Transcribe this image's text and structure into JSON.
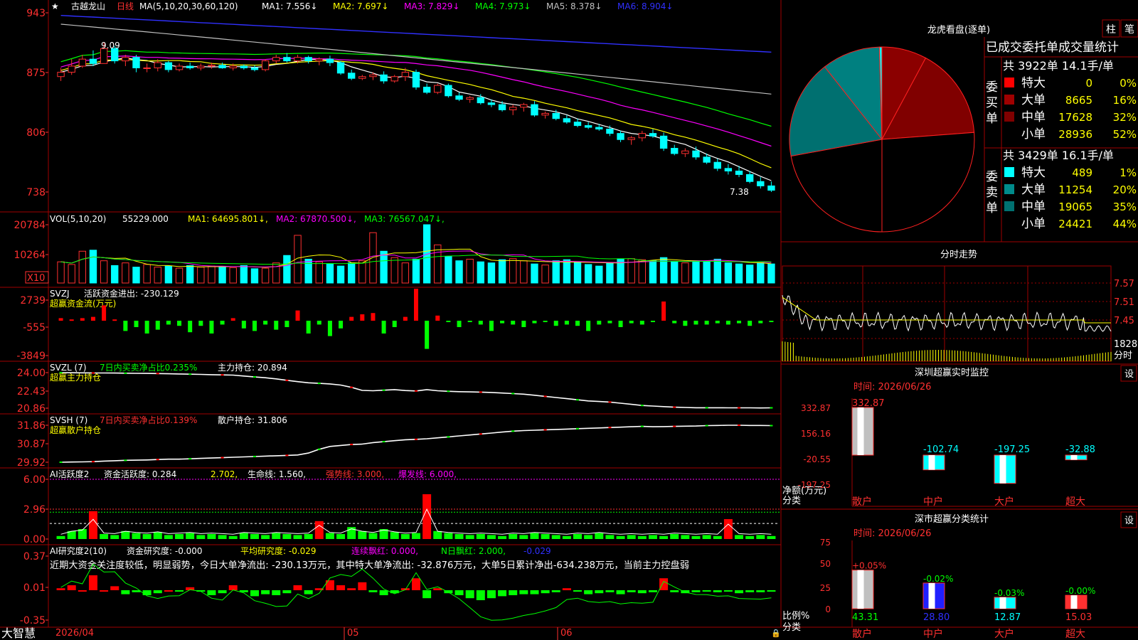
{
  "colors": {
    "red": "#ff3030",
    "cyan": "#00ffff",
    "white": "#ffffff",
    "yellow": "#ffff00",
    "magenta": "#ff00ff",
    "green": "#00ff00",
    "blue": "#3030ff",
    "gray": "#c0c0c0",
    "darkred": "#8b0000",
    "teal": "#008080",
    "grid": "#a00000"
  },
  "main_chart": {
    "star": "★",
    "stock_name": "古越龙山",
    "period": "日线",
    "ma_params": "MA(5,10,20,30,60,120)",
    "ma_values": [
      {
        "label": "MA1:",
        "value": "7.556",
        "arrow": "↓",
        "color": "#ffffff"
      },
      {
        "label": "MA2:",
        "value": "7.697",
        "arrow": "↓",
        "color": "#ffff00"
      },
      {
        "label": "MA3:",
        "value": "7.829",
        "arrow": "↓",
        "color": "#ff00ff"
      },
      {
        "label": "MA4:",
        "value": "7.973",
        "arrow": "↓",
        "color": "#00ff00"
      },
      {
        "label": "MA5:",
        "value": "8.378",
        "arrow": "↓",
        "color": "#c0c0c0"
      },
      {
        "label": "MA6:",
        "value": "8.904",
        "arrow": "↓",
        "color": "#3030ff"
      }
    ],
    "y_labels": [
      "943",
      "875",
      "806",
      "738"
    ],
    "high_label": "9.09",
    "low_label": "7.38"
  },
  "volume_panel": {
    "title": "VOL(5,10,20)",
    "current": "55229.000",
    "ma": [
      {
        "label": "MA1:",
        "value": "64695.801",
        "color": "#ffff00"
      },
      {
        "label": "MA2:",
        "value": "67870.500",
        "color": "#ff00ff"
      },
      {
        "label": "MA3:",
        "value": "76567.047",
        "color": "#00ff00"
      }
    ],
    "y_labels": [
      "20784",
      "10264"
    ],
    "unit": "X10"
  },
  "svzj_panel": {
    "title": "SVZJ",
    "line1": "活跃资金进出: -230.129",
    "line2": "超赢资金流(万元)",
    "y_labels": [
      "2739",
      "-555",
      "-3849"
    ]
  },
  "svzl_panel": {
    "title": "SVZL (7)",
    "ratio_text": "7日内买卖净占比0.235%",
    "hold_text": "主力持仓: 20.894",
    "subtitle": "超赢主力持仓",
    "y_labels": [
      "24.00",
      "22.43",
      "20.86"
    ]
  },
  "svsh_panel": {
    "title": "SVSH (7)",
    "ratio_text": "7日内买卖净占比0.139%",
    "hold_text": "散户持仓: 31.806",
    "subtitle": "超赢散户持仓",
    "y_labels": [
      "31.86",
      "30.87",
      "29.92"
    ]
  },
  "ai_active_panel": {
    "title": "AI活跃度2",
    "text1": "资金活跃度: 0.284",
    "text2": "2.702,",
    "text3": "生命线: 1.560,",
    "text4": "强势线: 3.000,",
    "text5": "爆发线: 6.000,",
    "y_labels": [
      "6.00",
      "2.96",
      "0.00"
    ]
  },
  "ai_research_panel": {
    "title": "AI研究度2(10)",
    "text1": "资金研究度: -0.000",
    "text2": "平均研究度: -0.029",
    "text3": "连续飘红: 0.000,",
    "text4": "N日飘红: 2.000,",
    "text5": "-0.029",
    "commentary": "近期大资金关注度较低，明显弱势，今日大单净流出: -230.13万元，其中特大单净流出: -32.876万元，大单5日累计净出-634.238万元，当前主力控盘弱",
    "y_labels": [
      "0.37",
      "0.01",
      "-0.35"
    ]
  },
  "bottom_bar": {
    "brand": "大智慧",
    "date": "2026/04",
    "month_labels": [
      "05",
      "06"
    ]
  },
  "right_panel": {
    "dragon_title": "龙虎看盘(逐单)",
    "btn1": "柱",
    "btn2": "笔",
    "stats_header": "已成交委托单成交量统计",
    "buy_label": "委买单",
    "sell_label": "委卖单",
    "buy_summary": "共 3922单 14.1手/单",
    "sell_summary": "共 3429单 16.1手/单",
    "buy_rows": [
      {
        "name": "特大",
        "value": "0",
        "pct": "0%",
        "color": "#ff0000"
      },
      {
        "name": "大单",
        "value": "8665",
        "pct": "16%",
        "color": "#a00000"
      },
      {
        "name": "中单",
        "value": "17628",
        "pct": "32%",
        "color": "#800000"
      },
      {
        "name": "小单",
        "value": "28936",
        "pct": "52%",
        "color": "#000000"
      }
    ],
    "sell_rows": [
      {
        "name": "特大",
        "value": "489",
        "pct": "1%",
        "color": "#00ffff"
      },
      {
        "name": "大单",
        "value": "11254",
        "pct": "20%",
        "color": "#008b8b"
      },
      {
        "name": "中单",
        "value": "19065",
        "pct": "35%",
        "color": "#007070"
      },
      {
        "name": "小单",
        "value": "24421",
        "pct": "44%",
        "color": "#000000"
      }
    ],
    "fenshi_title": "分时走势",
    "fenshi_y": [
      "7.57",
      "7.51",
      "7.45"
    ],
    "fenshi_vol": "1828",
    "fenshi_vol_unit": "分时",
    "sz_monitor_title": "深圳超赢实时监控",
    "sz_monitor_btn": "设",
    "sz_monitor_time": "时间: 2026/06/26",
    "sz_monitor_y": [
      "332.87",
      "156.16",
      "-20.55",
      "-197.25"
    ],
    "sz_monitor_unit": "净额(万元)",
    "sz_monitor_cat_label": "分类",
    "sz_monitor_bars": [
      {
        "cat": "散户",
        "value": 332.87,
        "label": "332.87"
      },
      {
        "cat": "中户",
        "value": -102.74,
        "label": "-102.74"
      },
      {
        "cat": "大户",
        "value": -197.25,
        "label": "-197.25"
      },
      {
        "cat": "超大",
        "value": -32.88,
        "label": "-32.88"
      }
    ],
    "sz_class_title": "深市超赢分类统计",
    "sz_class_btn": "设",
    "sz_class_time": "时间: 2026/06/26",
    "sz_class_y": [
      "75",
      "50",
      "25",
      "0"
    ],
    "sz_class_unit": "比例%",
    "sz_class_cat_label": "分类",
    "sz_class_bars": [
      {
        "cat": "散户",
        "value": 43.31,
        "change": "+0.05%",
        "label": "43.31"
      },
      {
        "cat": "中户",
        "value": 28.8,
        "change": "-0.02%",
        "label": "28.80"
      },
      {
        "cat": "大户",
        "value": 12.87,
        "change": "-0.03%",
        "label": "12.87"
      },
      {
        "cat": "超大",
        "value": 15.03,
        "change": "-0.00%",
        "label": "15.03"
      }
    ]
  },
  "chart_data": {
    "type": "candlestick",
    "title": "古越龙山 日线",
    "ylim": [
      7.38,
      9.43
    ],
    "candles": [
      [
        8.7,
        8.8,
        8.65,
        8.75
      ],
      [
        8.75,
        8.9,
        8.72,
        8.82
      ],
      [
        8.82,
        8.95,
        8.8,
        8.9
      ],
      [
        8.9,
        9.0,
        8.82,
        8.85
      ],
      [
        8.85,
        9.09,
        8.85,
        9.02
      ],
      [
        9.02,
        9.05,
        8.85,
        8.88
      ],
      [
        8.88,
        8.95,
        8.82,
        8.92
      ],
      [
        8.92,
        8.95,
        8.75,
        8.8
      ],
      [
        8.8,
        8.85,
        8.75,
        8.8
      ],
      [
        8.8,
        8.9,
        8.76,
        8.86
      ],
      [
        8.86,
        8.88,
        8.75,
        8.78
      ],
      [
        8.78,
        8.85,
        8.76,
        8.82
      ],
      [
        8.82,
        8.86,
        8.78,
        8.8
      ],
      [
        8.8,
        8.85,
        8.77,
        8.82
      ],
      [
        8.82,
        8.86,
        8.79,
        8.83
      ],
      [
        8.83,
        8.86,
        8.79,
        8.8
      ],
      [
        8.8,
        8.85,
        8.77,
        8.82
      ],
      [
        8.82,
        8.84,
        8.78,
        8.8
      ],
      [
        8.8,
        8.83,
        8.76,
        8.78
      ],
      [
        8.78,
        8.9,
        8.76,
        8.88
      ],
      [
        8.88,
        8.95,
        8.85,
        8.92
      ],
      [
        8.92,
        8.97,
        8.86,
        8.88
      ],
      [
        8.88,
        8.95,
        8.85,
        8.92
      ],
      [
        8.92,
        8.94,
        8.85,
        8.88
      ],
      [
        8.88,
        8.92,
        8.83,
        8.9
      ],
      [
        8.9,
        8.94,
        8.82,
        8.86
      ],
      [
        8.86,
        8.88,
        8.72,
        8.74
      ],
      [
        8.74,
        8.78,
        8.66,
        8.68
      ],
      [
        8.68,
        8.72,
        8.66,
        8.7
      ],
      [
        8.7,
        8.75,
        8.66,
        8.72
      ],
      [
        8.72,
        8.76,
        8.62,
        8.65
      ],
      [
        8.65,
        8.72,
        8.63,
        8.7
      ],
      [
        8.7,
        8.8,
        8.65,
        8.75
      ],
      [
        8.75,
        8.78,
        8.55,
        8.58
      ],
      [
        8.58,
        8.62,
        8.5,
        8.52
      ],
      [
        8.52,
        8.62,
        8.5,
        8.6
      ],
      [
        8.6,
        8.62,
        8.46,
        8.48
      ],
      [
        8.48,
        8.52,
        8.42,
        8.44
      ],
      [
        8.44,
        8.48,
        8.4,
        8.46
      ],
      [
        8.46,
        8.5,
        8.38,
        8.4
      ],
      [
        8.4,
        8.44,
        8.35,
        8.38
      ],
      [
        8.38,
        8.42,
        8.3,
        8.32
      ],
      [
        8.32,
        8.38,
        8.26,
        8.35
      ],
      [
        8.35,
        8.4,
        8.3,
        8.38
      ],
      [
        8.38,
        8.42,
        8.24,
        8.26
      ],
      [
        8.26,
        8.3,
        8.22,
        8.28
      ],
      [
        8.28,
        8.32,
        8.2,
        8.22
      ],
      [
        8.22,
        8.26,
        8.16,
        8.18
      ],
      [
        8.18,
        8.22,
        8.12,
        8.14
      ],
      [
        8.14,
        8.18,
        8.1,
        8.12
      ],
      [
        8.12,
        8.16,
        8.08,
        8.1
      ],
      [
        8.1,
        8.14,
        8.02,
        8.05
      ],
      [
        8.05,
        8.08,
        7.95,
        7.98
      ],
      [
        7.98,
        8.02,
        7.92,
        8.0
      ],
      [
        8.0,
        8.08,
        7.96,
        8.05
      ],
      [
        8.05,
        8.1,
        8.0,
        8.02
      ],
      [
        8.02,
        8.06,
        7.85,
        7.88
      ],
      [
        7.88,
        7.92,
        7.8,
        7.82
      ],
      [
        7.82,
        7.88,
        7.78,
        7.85
      ],
      [
        7.85,
        7.9,
        7.75,
        7.78
      ],
      [
        7.78,
        7.82,
        7.7,
        7.72
      ],
      [
        7.72,
        7.76,
        7.62,
        7.65
      ],
      [
        7.65,
        7.7,
        7.58,
        7.62
      ],
      [
        7.62,
        7.68,
        7.55,
        7.58
      ],
      [
        7.58,
        7.62,
        7.48,
        7.5
      ],
      [
        7.5,
        7.55,
        7.42,
        7.45
      ],
      [
        7.45,
        7.5,
        7.38,
        7.4
      ]
    ],
    "volume": [
      40,
      35,
      60,
      62,
      42,
      33,
      38,
      30,
      35,
      30,
      32,
      28,
      33,
      30,
      32,
      31,
      29,
      33,
      27,
      28,
      38,
      52,
      90,
      45,
      40,
      36,
      32,
      38,
      42,
      95,
      60,
      48,
      38,
      45,
      110,
      72,
      50,
      42,
      45,
      40,
      38,
      44,
      46,
      42,
      36,
      34,
      42,
      44,
      40,
      35,
      32,
      38,
      45,
      46,
      44,
      42,
      48,
      40,
      38,
      42,
      40,
      45,
      38,
      36,
      34,
      38,
      36
    ],
    "svzj": [
      0.2,
      0.1,
      0.2,
      0.3,
      1.2,
      0.1,
      -0.8,
      -0.5,
      -1.0,
      -0.7,
      -0.3,
      -0.4,
      -0.9,
      -0.4,
      -1.0,
      -0.3,
      0.2,
      -0.6,
      -0.8,
      -0.3,
      -0.7,
      -0.5,
      0.8,
      -1.0,
      -0.3,
      -1.2,
      -0.6,
      0.3,
      0.5,
      0.6,
      -1.0,
      -0.5,
      0.3,
      2.5,
      -2.2,
      0.4,
      -0.1,
      -0.5,
      -0.1,
      -0.3,
      -0.8,
      -0.2,
      -0.3,
      -0.5,
      -0.2,
      -0.1,
      -0.4,
      -0.3,
      -0.4,
      -0.8,
      -0.3,
      -0.2,
      -0.5,
      -0.2,
      -0.3,
      -0.1,
      1.5,
      -0.2,
      -0.4,
      -0.3,
      -0.3,
      -0.2,
      -0.3,
      -0.2,
      -0.4,
      -0.2,
      -0.1
    ],
    "svzl": [
      24.0,
      23.99,
      23.98,
      23.97,
      23.97,
      23.96,
      23.95,
      23.94,
      23.93,
      23.92,
      23.9,
      23.88,
      23.86,
      23.84,
      23.82,
      23.8,
      23.78,
      23.7,
      23.62,
      23.55,
      23.45,
      23.32,
      23.2,
      23.1,
      23.05,
      23.0,
      22.9,
      22.7,
      22.43,
      22.4,
      22.45,
      22.5,
      22.42,
      22.38,
      22.5,
      22.4,
      22.35,
      22.32,
      22.3,
      22.28,
      22.25,
      22.2,
      22.15,
      22.1,
      22.0,
      21.9,
      21.8,
      21.7,
      21.6,
      21.5,
      21.45,
      21.4,
      21.3,
      21.2,
      21.1,
      21.05,
      21.0,
      20.95,
      20.92,
      20.9,
      20.9,
      20.9,
      20.89,
      20.89,
      20.89,
      20.88,
      20.89
    ],
    "svsh": [
      29.92,
      29.93,
      29.94,
      29.95,
      29.98,
      30.0,
      30.02,
      30.03,
      30.04,
      30.06,
      30.08,
      30.08,
      30.1,
      30.12,
      30.14,
      30.16,
      30.18,
      30.2,
      30.22,
      30.24,
      30.26,
      30.28,
      30.3,
      30.4,
      30.6,
      30.75,
      30.8,
      30.85,
      30.87,
      30.95,
      31.0,
      31.05,
      31.1,
      31.12,
      31.15,
      31.2,
      31.25,
      31.3,
      31.35,
      31.4,
      31.45,
      31.5,
      31.55,
      31.58,
      31.6,
      31.62,
      31.64,
      31.66,
      31.68,
      31.7,
      31.72,
      31.74,
      31.76,
      31.78,
      31.8,
      31.78,
      31.79,
      31.8,
      31.81,
      31.82,
      31.84,
      31.85,
      31.86,
      31.86,
      31.85,
      31.85,
      31.84
    ],
    "ai_active": [
      0.3,
      0.8,
      1.0,
      2.8,
      0.5,
      0.4,
      0.8,
      0.6,
      0.5,
      0.7,
      0.4,
      0.5,
      0.6,
      0.4,
      0.5,
      0.4,
      0.3,
      0.6,
      0.5,
      0.4,
      0.6,
      0.5,
      0.4,
      0.5,
      1.8,
      0.6,
      0.5,
      1.2,
      0.8,
      0.6,
      1.0,
      0.7,
      0.5,
      0.6,
      4.5,
      0.8,
      0.6,
      0.5,
      0.4,
      0.5,
      0.4,
      0.3,
      0.5,
      0.4,
      0.6,
      0.5,
      0.4,
      0.3,
      0.5,
      0.4,
      0.6,
      0.4,
      0.3,
      0.4,
      0.3,
      0.4,
      0.3,
      0.5,
      0.4,
      0.3,
      0.4,
      0.3,
      2.0,
      0.4,
      0.3,
      0.4,
      0.3
    ],
    "ai_research": [
      0.02,
      0.05,
      0.0,
      0.15,
      0.0,
      0.04,
      -0.04,
      -0.02,
      -0.05,
      -0.03,
      0.0,
      -0.01,
      0.03,
      -0.01,
      -0.05,
      -0.03,
      0.05,
      -0.02,
      -0.06,
      -0.04,
      -0.05,
      -0.03,
      0.05,
      -0.04,
      0.02,
      0.1,
      0.05,
      0.02,
      0.08,
      -0.02,
      -0.05,
      -0.03,
      0.02,
      0.12,
      -0.08,
      0.02,
      -0.03,
      -0.05,
      -0.08,
      -0.1,
      -0.08,
      -0.06,
      -0.05,
      -0.04,
      -0.04,
      -0.03,
      -0.02,
      0.02,
      -0.01,
      -0.04,
      -0.03,
      -0.02,
      -0.04,
      -0.02,
      -0.03,
      -0.02,
      0.12,
      -0.02,
      -0.03,
      -0.02,
      -0.01,
      -0.02,
      -0.01,
      -0.03,
      -0.02,
      -0.02,
      -0.01
    ]
  }
}
